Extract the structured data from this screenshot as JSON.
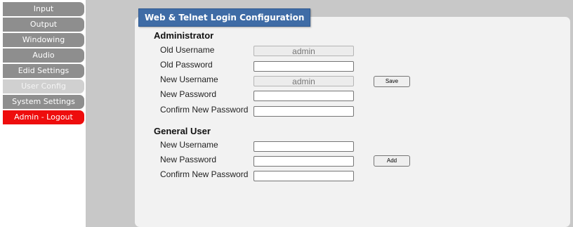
{
  "sidebar": {
    "items": [
      {
        "label": "Input"
      },
      {
        "label": "Output"
      },
      {
        "label": "Windowing"
      },
      {
        "label": "Audio"
      },
      {
        "label": "Edid Settings"
      },
      {
        "label": "User Config"
      },
      {
        "label": "System Settings"
      },
      {
        "label": "Admin - Logout"
      }
    ],
    "active_item": "User Config"
  },
  "panel": {
    "title": "Web & Telnet Login Configuration",
    "administrator": {
      "heading": "Administrator",
      "old_username_label": "Old Username",
      "old_username_value": "admin",
      "old_password_label": "Old Password",
      "old_password_value": "",
      "new_username_label": "New Username",
      "new_username_value": "admin",
      "new_password_label": "New Password",
      "new_password_value": "",
      "confirm_password_label": "Confirm New Password",
      "confirm_password_value": "",
      "save_label": "Save"
    },
    "general_user": {
      "heading": "General User",
      "new_username_label": "New Username",
      "new_username_value": "",
      "new_password_label": "New Password",
      "new_password_value": "",
      "confirm_password_label": "Confirm New Password",
      "confirm_password_value": "",
      "add_label": "Add"
    }
  },
  "colors": {
    "nav_default": "#8e8e8e",
    "nav_active": "#d0d0d0",
    "nav_logout": "#ee0d0d",
    "title_bar": "#3f6ca6",
    "background": "#c8c8c8",
    "panel": "#f2f2f2"
  }
}
